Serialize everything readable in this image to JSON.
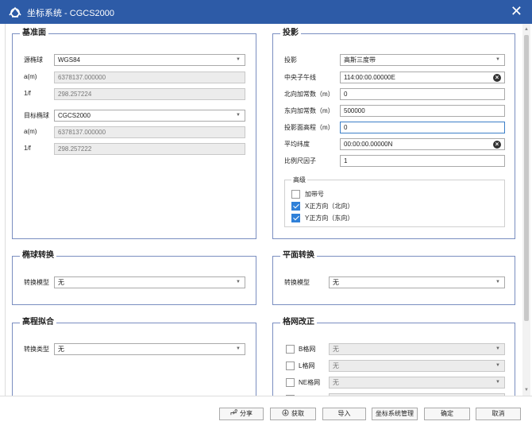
{
  "window": {
    "title": "坐标系统 - CGCS2000",
    "close": "✕"
  },
  "datum": {
    "title": "基准面",
    "source_label": "源椭球",
    "source_value": "WGS84",
    "a_label": "a(m)",
    "a_value": "6378137.000000",
    "f_label": "1/f",
    "f_value": "298.257224",
    "target_label": "目标椭球",
    "target_value": "CGCS2000",
    "ta_label": "a(m)",
    "ta_value": "6378137.000000",
    "tf_label": "1/f",
    "tf_value": "298.257222"
  },
  "projection": {
    "title": "投影",
    "proj_label": "投影",
    "proj_value": "高斯三度带",
    "cm_label": "中央子午线",
    "cm_value": "114:00:00.00000E",
    "fn_label": "北向加常数（m）",
    "fn_value": "0",
    "fe_label": "东向加常数（m）",
    "fe_value": "500000",
    "h_label": "投影面高程（m）",
    "h_value": "0",
    "lat_label": "平均纬度",
    "lat_value": "00:00:00.00000N",
    "scale_label": "比例尺因子",
    "scale_value": "1",
    "advanced": {
      "title": "高级",
      "items": [
        {
          "label": "加带号",
          "checked": false
        },
        {
          "label": "X正方向（北向）",
          "checked": true
        },
        {
          "label": "Y正方向（东向）",
          "checked": true
        }
      ]
    }
  },
  "ellipsoid_transform": {
    "title": "椭球转换",
    "model_label": "转换模型",
    "model_value": "无"
  },
  "plane_transform": {
    "title": "平面转换",
    "model_label": "转换模型",
    "model_value": "无"
  },
  "height_fit": {
    "title": "高程拟合",
    "type_label": "转换类型",
    "type_value": "无"
  },
  "grid_correction": {
    "title": "格网改正",
    "rows": [
      {
        "label": "B格网",
        "value": "无"
      },
      {
        "label": "L格网",
        "value": "无"
      },
      {
        "label": "NE格网",
        "value": "无"
      }
    ]
  },
  "footer": {
    "share": "分享",
    "get": "获取",
    "import": "导入",
    "manage": "坐标系统管理",
    "ok": "确定",
    "cancel": "取消"
  }
}
